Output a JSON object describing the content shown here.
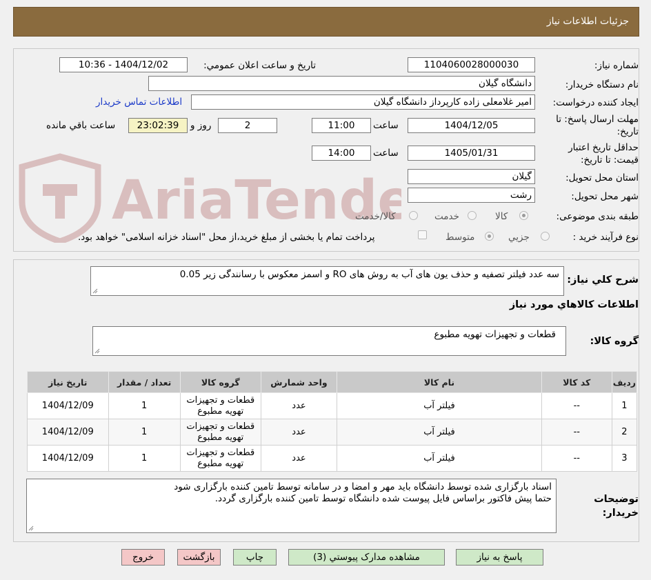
{
  "header": {
    "title": "جزئیات اطلاعات نیاز"
  },
  "watermark": {
    "text": "AriaTender.neT"
  },
  "form": {
    "need_number": {
      "label": "شماره نیاز:",
      "value": "1104060028000030"
    },
    "announce": {
      "label": "تاریخ و ساعت اعلان عمومي:",
      "value": "1404/12/02 - 10:36"
    },
    "buyer_org": {
      "label": "نام دستگاه خریدار:",
      "value": "دانشگاه گیلان"
    },
    "requester": {
      "label": "ایجاد کننده درخواست:",
      "value": "امیر غلامعلی زاده کارپرداز دانشگاه گیلان",
      "contact_link": "اطلاعات تماس خریدار"
    },
    "reply_deadline": {
      "label_line1": "مهلت ارسال پاسخ: تا",
      "label_line2": "تاریخ:",
      "date": "1404/12/05",
      "time_label": "ساعت",
      "time": "11:00",
      "days": "2",
      "days_label": "روز و",
      "remaining": "23:02:39",
      "remaining_label": "ساعت باقي مانده"
    },
    "price_validity": {
      "label_line1": "حداقل تاریخ اعتبار",
      "label_line2": "قیمت: تا تاریخ:",
      "date": "1405/01/31",
      "time_label": "ساعت",
      "time": "14:00"
    },
    "province": {
      "label": "استان محل تحویل:",
      "value": "گیلان"
    },
    "city": {
      "label": "شهر محل تحویل:",
      "value": "رشت"
    },
    "category": {
      "label": "طبقه بندی موضوعی:",
      "options": [
        "کالا",
        "خدمت",
        "کالا/خدمت"
      ],
      "selected": "کالا"
    },
    "purchase_type": {
      "label": "نوع فرآیند خرید :",
      "options": [
        "جزیي",
        "متوسط"
      ],
      "selected": "متوسط",
      "treasury_note": "پرداخت تمام یا بخشی از مبلغ خرید،از محل \"اسناد خزانه اسلامی\" خواهد بود."
    }
  },
  "summary": {
    "label": "شرح کلي نیاز:",
    "value": "سه عدد فیلتر تصفیه و حذف یون های آب به روش های RO و اسمز معکوس با رسانندگی زیر 0.05"
  },
  "goods_section": {
    "title": "اطلاعات کالاهاي مورد نیاز"
  },
  "goods_group": {
    "label": "گروه کالا:",
    "value": "قطعات و تجهیزات تهویه مطبوع"
  },
  "table": {
    "headers": [
      "ردیف",
      "کد کالا",
      "نام کالا",
      "واحد شمارش",
      "گروه کالا",
      "تعداد / مقدار",
      "تاریخ نیاز"
    ],
    "rows": [
      [
        "1",
        "--",
        "فیلتر آب",
        "عدد",
        "قطعات و تجهیزات تهویه مطبوع",
        "1",
        "1404/12/09"
      ],
      [
        "2",
        "--",
        "فیلتر آب",
        "عدد",
        "قطعات و تجهیزات تهویه مطبوع",
        "1",
        "1404/12/09"
      ],
      [
        "3",
        "--",
        "فیلتر آب",
        "عدد",
        "قطعات و تجهیزات تهویه مطبوع",
        "1",
        "1404/12/09"
      ]
    ]
  },
  "buyer_notes": {
    "label_line1": "توضیحات",
    "label_line2": "خریدار:",
    "line1": "اسناد بارگزاری شده توسط دانشگاه باید مهر و امضا و در سامانه توسط تامین کننده بارگزاری شود",
    "line2": "حتما پیش فاکتور براساس فایل پیوست شده دانشگاه توسط تامین کننده بارگزاری گردد."
  },
  "buttons": {
    "reply": "پاسخ به نیاز",
    "attachments": "مشاهده مدارک پیوستي (3)",
    "print": "چاپ",
    "back": "بازگشت",
    "exit": "خروج"
  },
  "colors": {
    "header_bg": "#8a6b3e",
    "button_green": "#cfe9c8",
    "button_red": "#f4c7c7",
    "link": "#1a39c8"
  }
}
